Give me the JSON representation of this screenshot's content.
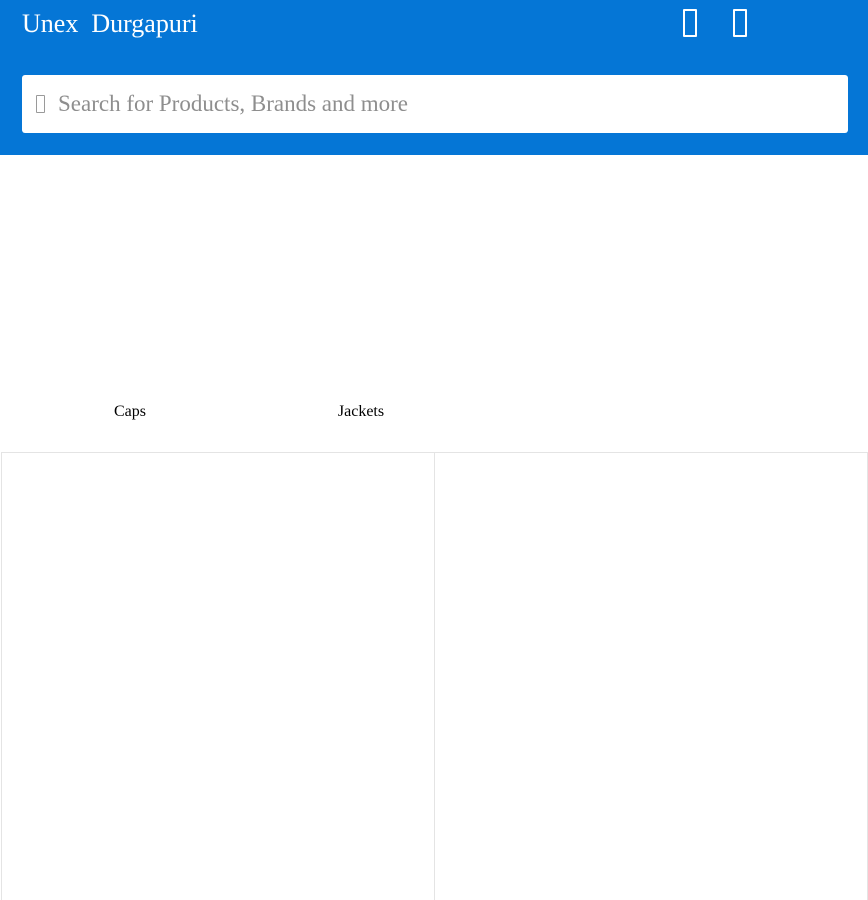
{
  "header": {
    "title": "Unex  Durgapuri",
    "icons": [
      "placeholder-glyph-icon",
      "placeholder-glyph-icon"
    ]
  },
  "search": {
    "placeholder": "Search for Products, Brands and more",
    "value": ""
  },
  "categories": [
    {
      "label": "Caps"
    },
    {
      "label": "Jackets"
    }
  ],
  "colors": {
    "header_bg": "#0576d6",
    "header_text": "#ffffff",
    "card_border": "#e4e4e4"
  }
}
